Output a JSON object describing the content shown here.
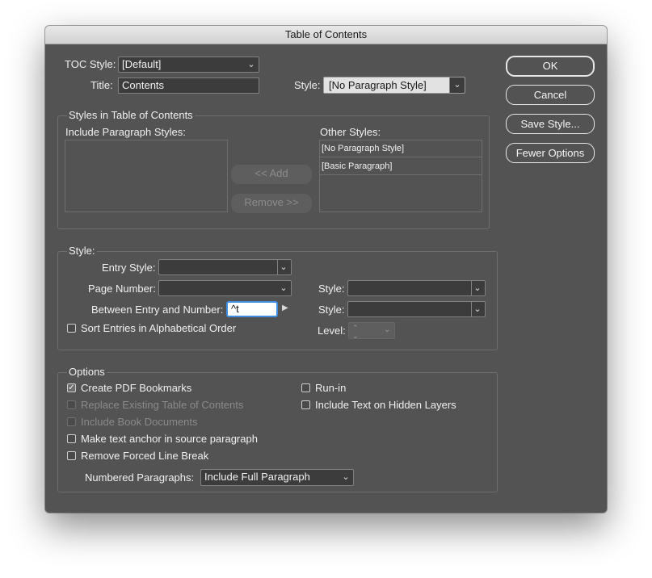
{
  "window": {
    "title": "Table of Contents"
  },
  "top": {
    "toc_style_label": "TOC Style:",
    "toc_style_value": "[Default]",
    "title_label": "Title:",
    "title_value": "Contents",
    "style_label": "Style:",
    "style_value": "[No Paragraph Style]"
  },
  "buttons": {
    "ok": "OK",
    "cancel": "Cancel",
    "save_style": "Save Style...",
    "fewer_options": "Fewer Options"
  },
  "styles_group": {
    "title": "Styles in Table of Contents",
    "include_label": "Include Paragraph Styles:",
    "other_label": "Other Styles:",
    "add_label": "<< Add",
    "remove_label": "Remove >>",
    "other_items": [
      "[No Paragraph Style]",
      "[Basic Paragraph]"
    ]
  },
  "style_group": {
    "title": "Style:",
    "entry_style_label": "Entry Style:",
    "entry_style_value": "",
    "page_number_label": "Page Number:",
    "page_number_value": "",
    "page_style_label": "Style:",
    "page_style_value": "",
    "between_label": "Between Entry and Number:",
    "between_value": "^t",
    "between_style_label": "Style:",
    "between_style_value": "",
    "sort_label": "Sort Entries in Alphabetical Order",
    "sort_checked": false,
    "level_label": "Level:"
  },
  "options_group": {
    "title": "Options",
    "create_pdf_bookmarks": {
      "label": "Create PDF Bookmarks",
      "checked": true,
      "enabled": true
    },
    "replace_existing": {
      "label": "Replace Existing Table of Contents",
      "checked": false,
      "enabled": false
    },
    "include_book_docs": {
      "label": "Include Book Documents",
      "checked": false,
      "enabled": false
    },
    "make_text_anchor": {
      "label": "Make text anchor in source paragraph",
      "checked": false,
      "enabled": true
    },
    "remove_forced_break": {
      "label": "Remove Forced Line Break",
      "checked": false,
      "enabled": true
    },
    "run_in": {
      "label": "Run-in",
      "checked": false,
      "enabled": true
    },
    "include_hidden_layers": {
      "label": "Include Text on Hidden Layers",
      "checked": false,
      "enabled": true
    },
    "numbered_label": "Numbered Paragraphs:",
    "numbered_value": "Include Full Paragraph"
  }
}
